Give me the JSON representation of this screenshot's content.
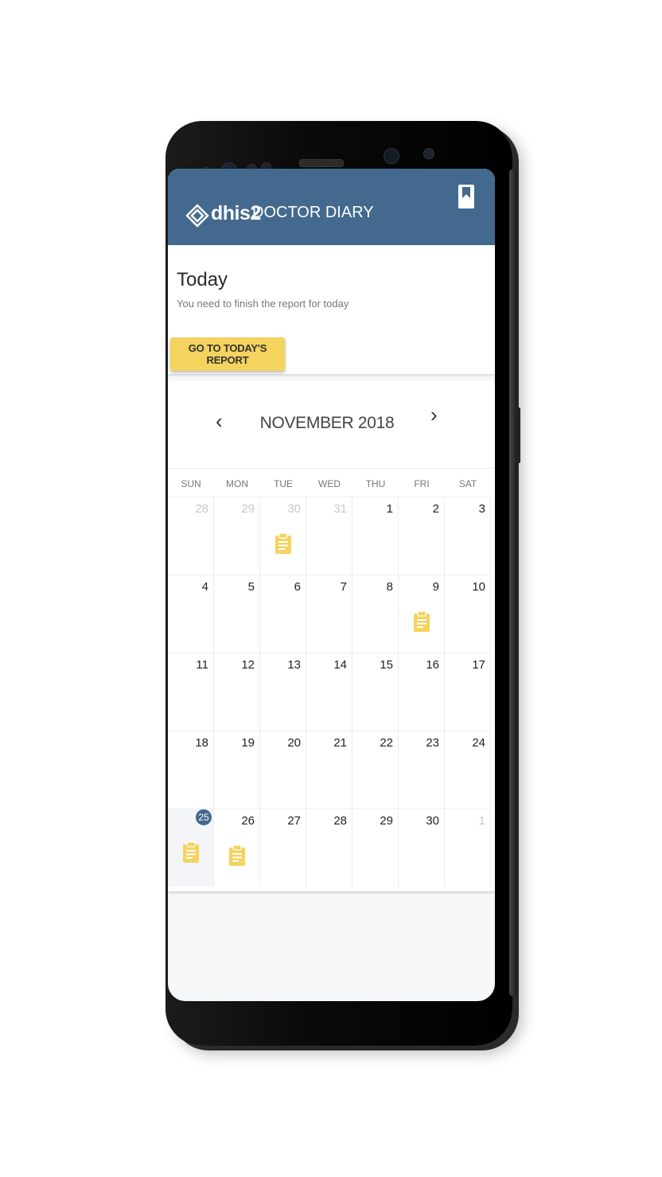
{
  "app": {
    "brand": "dhis2",
    "title": "DOCTOR DIARY",
    "bookmark_icon": "bookmark-icon",
    "accent": "#43698f",
    "highlight": "#f4d35e"
  },
  "today": {
    "title": "Today",
    "subtitle": "You need to finish the report for today",
    "button_label": "GO TO TODAY'S REPORT"
  },
  "calendar": {
    "month_label": "NOVEMBER 2018",
    "prev_icon": "chevron-left-icon",
    "next_icon": "chevron-right-icon",
    "prev_symbol": "‹",
    "next_symbol": "›",
    "weekdays": [
      "SUN",
      "MON",
      "TUE",
      "WED",
      "THU",
      "FRI",
      "SAT"
    ],
    "today": 25,
    "weeks": [
      [
        {
          "d": "28",
          "m": true
        },
        {
          "d": "29",
          "m": true
        },
        {
          "d": "30",
          "m": true,
          "r": true
        },
        {
          "d": "31",
          "m": true
        },
        {
          "d": "1"
        },
        {
          "d": "2"
        },
        {
          "d": "3"
        }
      ],
      [
        {
          "d": "4"
        },
        {
          "d": "5"
        },
        {
          "d": "6"
        },
        {
          "d": "7"
        },
        {
          "d": "8"
        },
        {
          "d": "9",
          "r": true
        },
        {
          "d": "10"
        }
      ],
      [
        {
          "d": "11"
        },
        {
          "d": "12"
        },
        {
          "d": "13"
        },
        {
          "d": "14"
        },
        {
          "d": "15"
        },
        {
          "d": "16"
        },
        {
          "d": "17"
        }
      ],
      [
        {
          "d": "18"
        },
        {
          "d": "19"
        },
        {
          "d": "20"
        },
        {
          "d": "21"
        },
        {
          "d": "22"
        },
        {
          "d": "23"
        },
        {
          "d": "24"
        }
      ],
      [
        {
          "d": "25",
          "t": true,
          "r": true
        },
        {
          "d": "26",
          "r": true
        },
        {
          "d": "27"
        },
        {
          "d": "28"
        },
        {
          "d": "29"
        },
        {
          "d": "30"
        },
        {
          "d": "1",
          "m": true
        }
      ]
    ],
    "report_icon": "clipboard-icon"
  }
}
